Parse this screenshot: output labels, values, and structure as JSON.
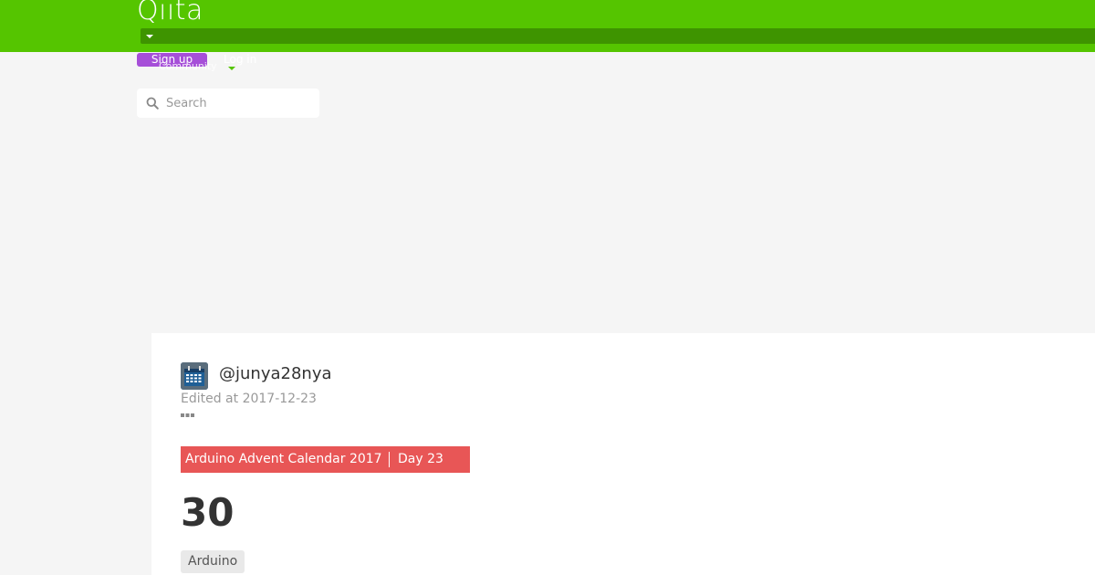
{
  "header": {
    "logo": "Qiita",
    "signup_label": "Sign up",
    "login_label": "Log in",
    "community_label": "Community"
  },
  "search": {
    "placeholder": "Search"
  },
  "article": {
    "author": "@junya28nya",
    "edited": "Edited at 2017-12-23",
    "calendar_name": "Arduino Advent Calendar 2017",
    "calendar_day": "Day 23",
    "title": "30",
    "tags": [
      "Arduino"
    ]
  },
  "colors": {
    "header_bg": "#55c500",
    "signup_bg": "#a64fd8",
    "banner_bg": "#e85656"
  },
  "icons": [
    "search-icon",
    "more-icon",
    "caret-down-icon"
  ]
}
